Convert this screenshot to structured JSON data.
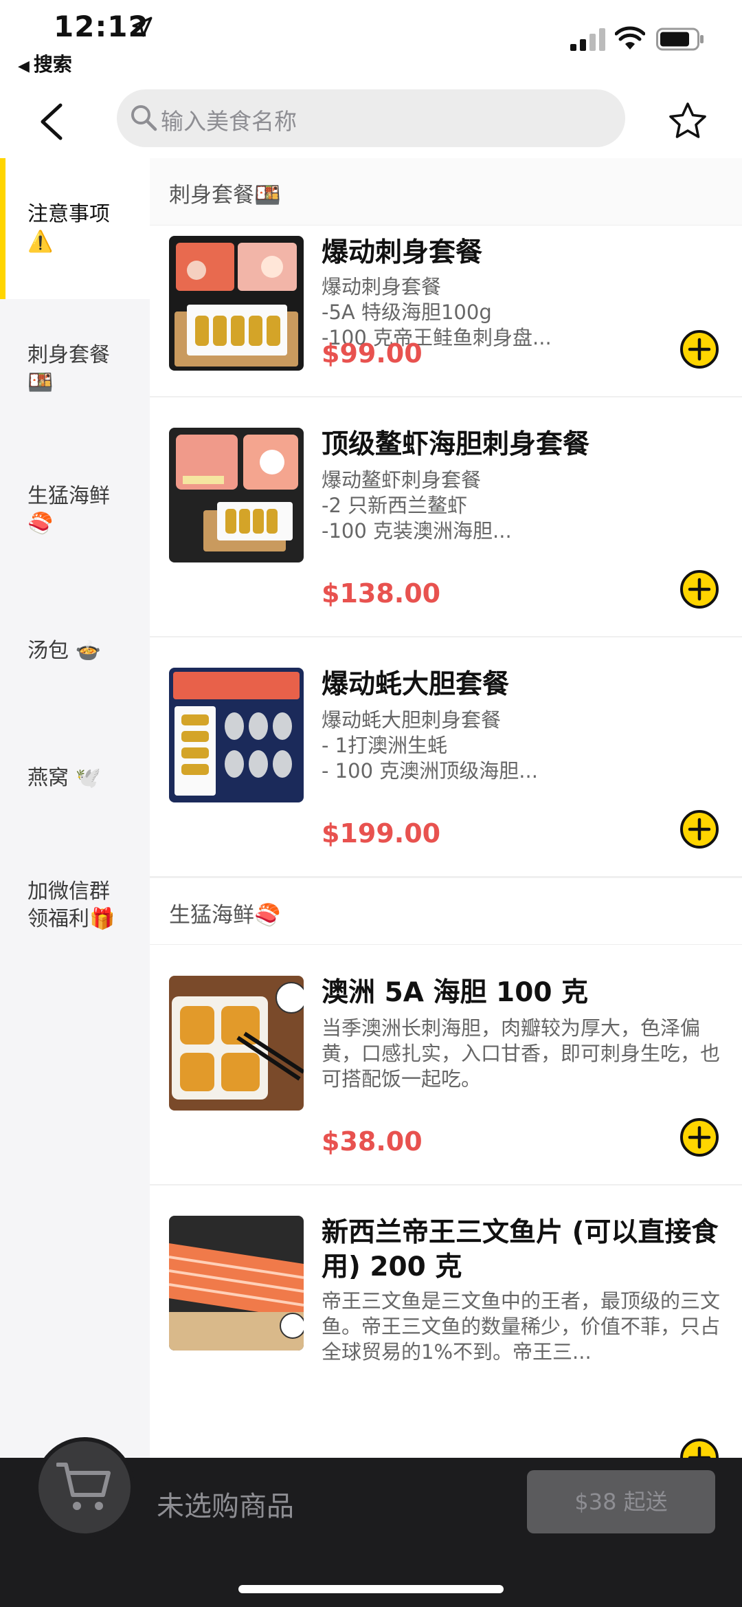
{
  "status_bar": {
    "time": "12:12",
    "back_app": "搜索"
  },
  "nav": {
    "search_placeholder": "输入美食名称"
  },
  "sidebar": {
    "items": [
      {
        "label": "注意事项\n⚠️"
      },
      {
        "label": "刺身套餐\n🍱"
      },
      {
        "label": "生猛海鲜\n🍣"
      },
      {
        "label": "汤包 🍲"
      },
      {
        "label": "燕窝 🕊️"
      },
      {
        "label": "加微信群\n领福利🎁"
      }
    ]
  },
  "sections": [
    {
      "title": "刺身套餐🍱",
      "products": [
        {
          "title": "爆动刺身套餐",
          "desc": "爆动刺身套餐\n-5A 特级海胆100g\n-100 克帝王鲑鱼刺身盘...",
          "price": "$99.00"
        },
        {
          "title": "顶级鳌虾海胆刺身套餐",
          "desc": "爆动鳌虾刺身套餐\n-2 只新西兰鳌虾\n-100 克装澳洲海胆...",
          "price": "$138.00"
        },
        {
          "title": "爆动蚝大胆套餐",
          "desc": "爆动蚝大胆刺身套餐\n- 1打澳洲生蚝\n- 100 克澳洲顶级海胆...",
          "price": "$199.00"
        }
      ]
    },
    {
      "title": "生猛海鲜🍣",
      "products": [
        {
          "title": "澳洲 5A 海胆 100 克",
          "desc": "当季澳洲长刺海胆，肉瓣较为厚大，色泽偏黄，口感扎实，入口甘香，即可刺身生吃，也可搭配饭一起吃。",
          "price": "$38.00"
        },
        {
          "title": "新西兰帝王三文鱼片 (可以直接食用) 200 克",
          "desc": "帝王三文鱼是三文鱼中的王者，最顶级的三文鱼。帝王三文鱼的数量稀少，价值不菲，只占全球贸易的1%不到。帝王三...",
          "price": ""
        }
      ]
    }
  ],
  "cart": {
    "empty_label": "未选购商品",
    "min_order": "$38 起送"
  },
  "colors": {
    "accent": "#ffd500",
    "price": "#e8524f",
    "cart_bar": "#1c1c1e"
  }
}
